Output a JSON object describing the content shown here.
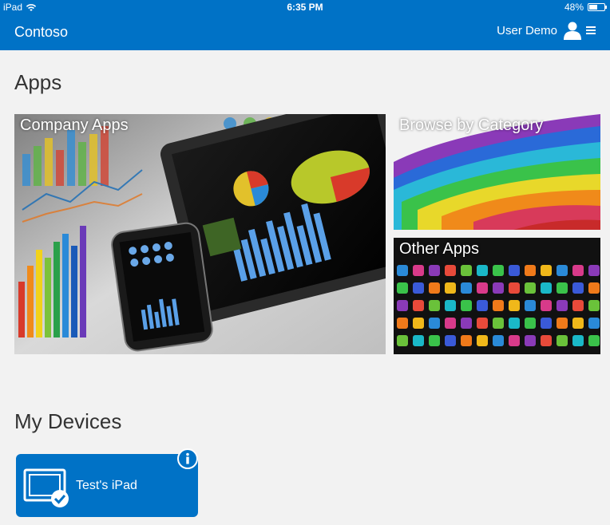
{
  "status_bar": {
    "device": "iPad",
    "time": "6:35 PM",
    "battery": "48%",
    "battery_level": 0.48,
    "icons": [
      "wifi-icon",
      "battery-icon"
    ]
  },
  "header": {
    "brand": "Contoso",
    "user_name": "User Demo",
    "icons": [
      "user-icon",
      "menu-icon"
    ]
  },
  "apps_section": {
    "title": "Apps",
    "tiles": [
      {
        "label": "Company Apps"
      },
      {
        "label": "Browse by Category"
      },
      {
        "label": "Other Apps"
      }
    ]
  },
  "devices_section": {
    "title": "My Devices",
    "devices": [
      {
        "name": "Test's iPad",
        "icons": [
          "tablet-icon",
          "check-icon",
          "info-icon"
        ]
      }
    ]
  },
  "colors": {
    "brand_blue": "#0072c6",
    "page_bg": "#f2f2f2",
    "title_text": "#333333"
  }
}
